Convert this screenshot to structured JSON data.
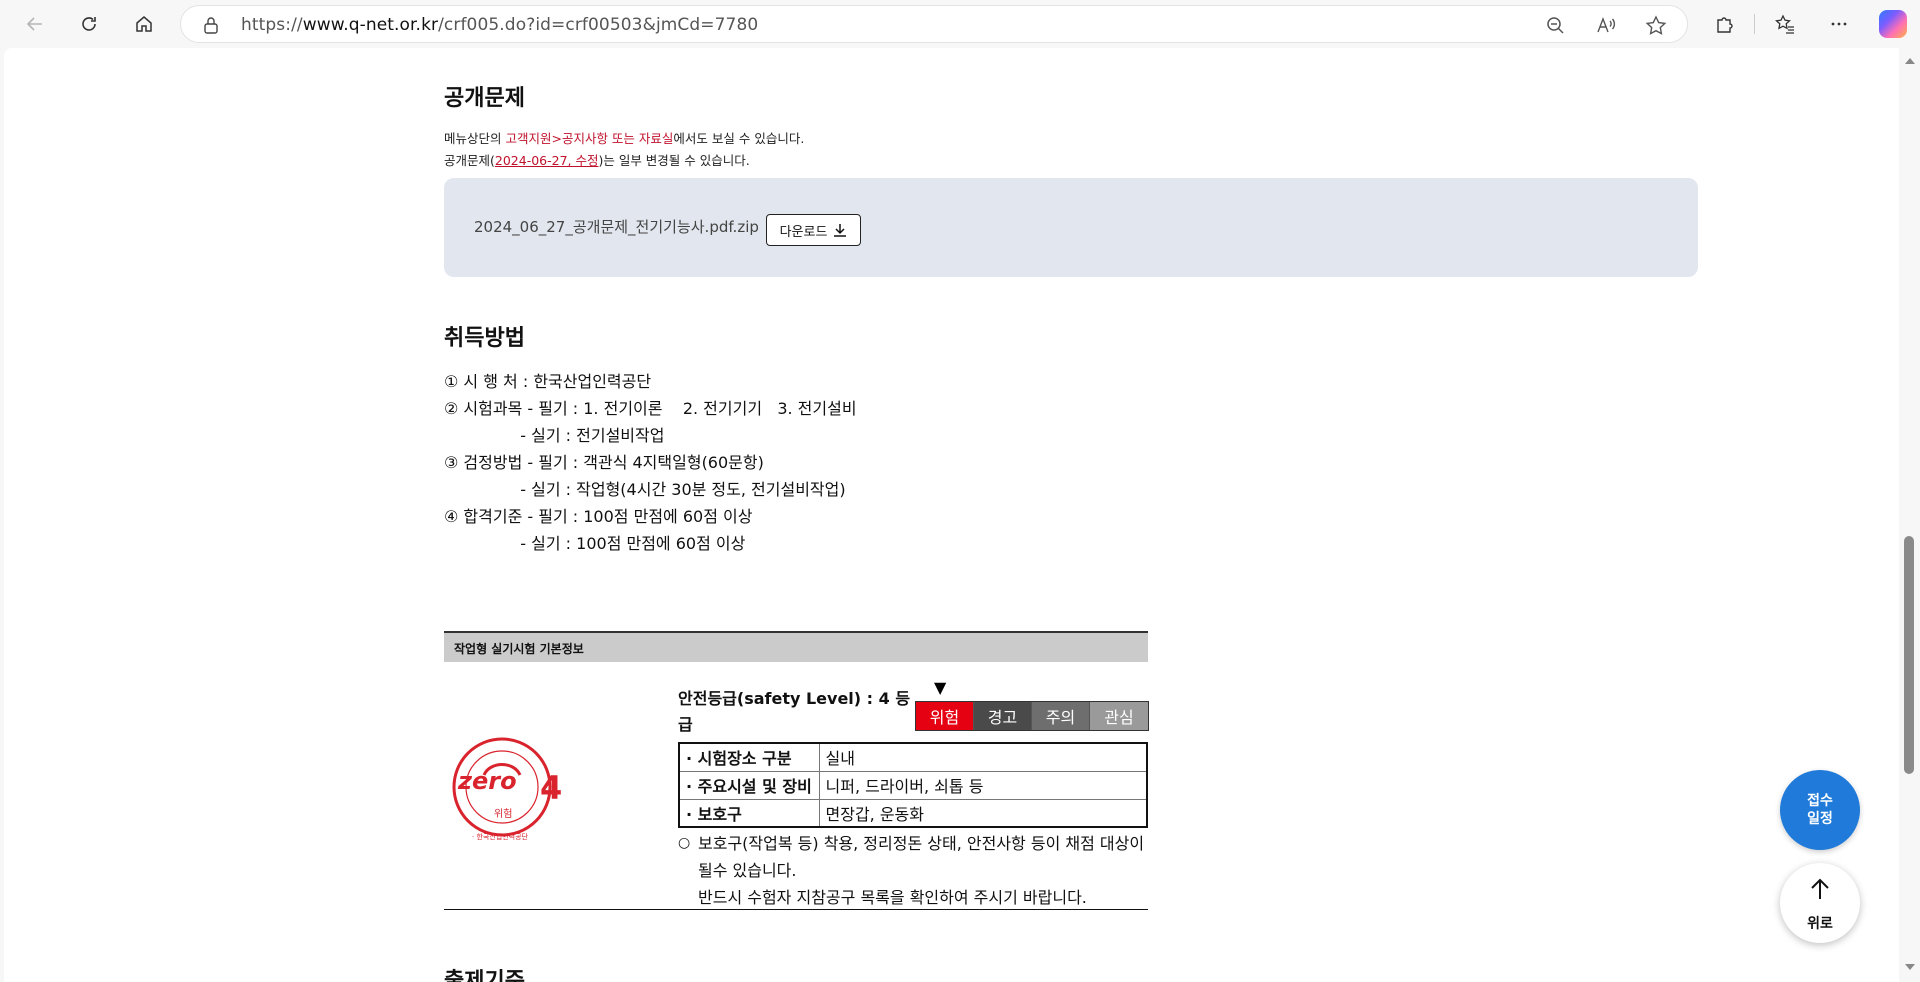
{
  "browser": {
    "url_prefix": "https://",
    "url_domain": "www.q-net.or.kr",
    "url_path": "/crf005.do?id=crf00503&jmCd=7780"
  },
  "public_questions": {
    "title": "공개문제",
    "notice1_prefix": "메뉴상단의 ",
    "notice1_link": "고객지원>공지사항 또는 자료실",
    "notice1_suffix": "에서도 보실 수 있습니다.",
    "notice2_prefix": "공개문제(",
    "notice2_link": "2024-06-27, 수정",
    "notice2_suffix": ")는 일부 변경될 수 있습니다.",
    "file_name": "2024_06_27_공개문제_전기기능사.pdf.zip",
    "download_label": "다운로드"
  },
  "acquisition": {
    "title": "취득방법",
    "lines": [
      "① 시 행 처 : 한국산업인력공단",
      "② 시험과목 - 필기 : 1. 전기이론    2. 전기기기   3. 전기설비",
      "               - 실기 : 전기설비작업",
      "③ 검정방법 - 필기 : 객관식 4지택일형(60문항)",
      "               - 실기 : 작업형(4시간 30분 정도, 전기설비작업)",
      "④ 합격기준 - 필기 : 100점 만점에 60점 이상",
      "               - 실기 : 100점 만점에 60점 이상"
    ]
  },
  "practical_info": {
    "header": "작업형 실기시험 기본정보",
    "safety_label": "안전등급(safety Level) : 4 등급",
    "pointer": "▼",
    "levels": [
      {
        "label": "위험",
        "color": "#e50012"
      },
      {
        "label": "경고",
        "color": "#4a4a4a"
      },
      {
        "label": "주의",
        "color": "#6e6e6e"
      },
      {
        "label": "관심",
        "color": "#9a9a9a"
      }
    ],
    "logo_text": "zero",
    "logo_number": "4",
    "logo_sub": "위험",
    "logo_ring": "· 한국산업인력공단",
    "table": [
      {
        "key": "· 시험장소 구분",
        "value": "실내"
      },
      {
        "key": "· 주요시설 및 장비",
        "value": "니퍼, 드라이버, 쇠톱 등"
      },
      {
        "key": "· 보호구",
        "value": "면장갑, 운동화"
      }
    ],
    "note_bullet": "○",
    "note_line1": "보호구(작업복 등) 착용, 정리정돈 상태, 안전사항 등이 채점 대상이 될수 있습니다.",
    "note_line2": "반드시 수험자 지참공구 목록을 확인하여 주시기 바랍니다."
  },
  "next_section_title": "출제기준",
  "fab": {
    "schedule_line1": "접수",
    "schedule_line2": "일정",
    "top_label": "위로"
  }
}
